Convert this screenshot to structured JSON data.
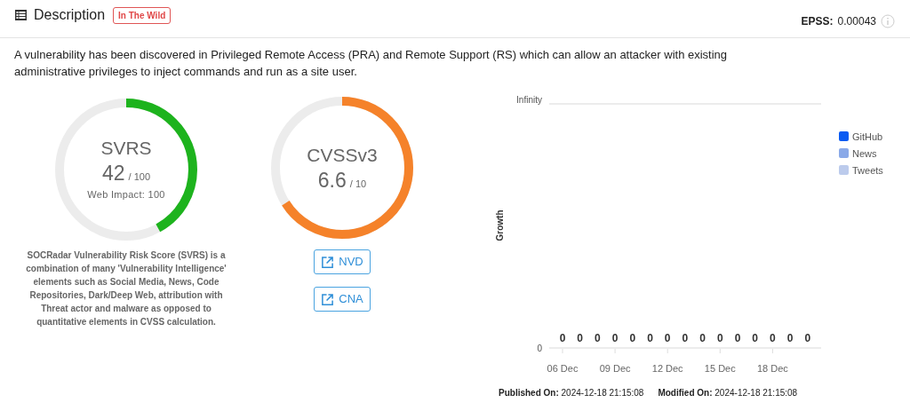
{
  "header": {
    "title": "Description",
    "badge": "In The Wild",
    "epss_label": "EPSS:",
    "epss_value": "0.00043"
  },
  "description": "A vulnerability has been discovered in Privileged Remote Access (PRA) and Remote Support (RS) which can allow an attacker with existing administrative privileges to inject commands and run as a site user.",
  "gauges": [
    {
      "title": "SVRS",
      "score": "42",
      "max": "/ 100",
      "sub": "Web Impact: 100",
      "level": 0.42,
      "color": "#1db31d"
    },
    {
      "title": "CVSSv3",
      "score": "6.6",
      "max": "/ 10",
      "level": 0.66,
      "color": "#f5822a"
    }
  ],
  "svrs_note": "SOCRadar Vulnerability Risk Score (SVRS) is a combination of many 'Vulnerability Intelligence' elements such as Social Media, News, Code Repositories, Dark/Deep Web, attribution with Threat actor and malware as opposed to quantitative elements in CVSS calculation.",
  "links": [
    "NVD",
    "CNA"
  ],
  "growth": {
    "y_title": "Growth",
    "y_axis_labels": [
      "Infinity",
      "0"
    ],
    "point_labels": [
      "0",
      "0",
      "0",
      "0",
      "0",
      "0",
      "0",
      "0",
      "0",
      "0",
      "0",
      "0",
      "0",
      "0",
      "0"
    ],
    "x_labels": [
      "06 Dec",
      "09 Dec",
      "12 Dec",
      "15 Dec",
      "18 Dec"
    ],
    "legend": [
      {
        "name": "GitHub",
        "color": "#0b5bf2"
      },
      {
        "name": "News",
        "color": "#8aa9e8"
      },
      {
        "name": "Tweets",
        "color": "#bccbec"
      }
    ]
  },
  "published": {
    "label": "Published On:",
    "value": "2024-12-18 21:15:08"
  },
  "modified": {
    "label": "Modified On:",
    "value": "2024-12-18 21:15:08"
  }
}
